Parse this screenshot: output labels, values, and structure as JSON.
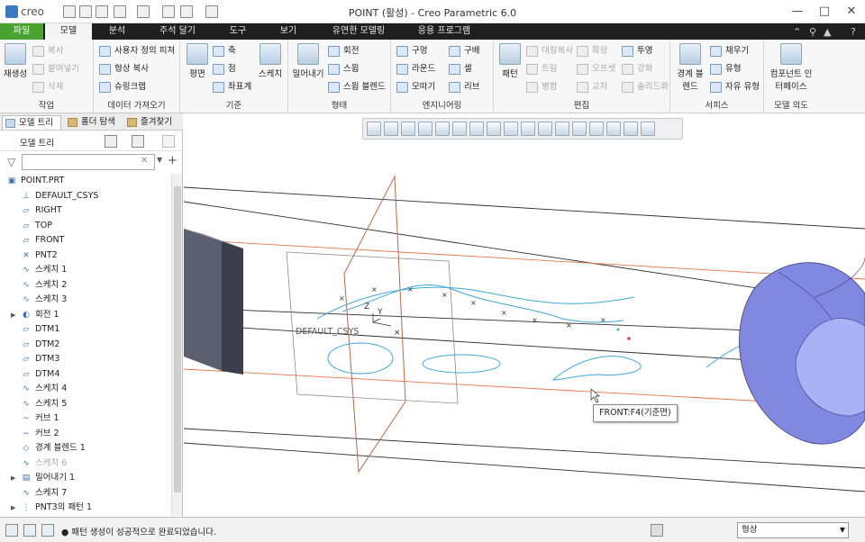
{
  "window": {
    "logo_text": "creo",
    "title": "POINT (활성) - Creo Parametric 6.0",
    "minimize": "—",
    "maximize": "□",
    "close": "✕"
  },
  "tabs": [
    "파일",
    "모델",
    "분석",
    "주석 달기",
    "도구",
    "보기",
    "유연한 모델링",
    "응용 프로그램"
  ],
  "ribbon": {
    "groups": {
      "operations": "작업",
      "get_data": "데이터 가져오기",
      "datum": "기준",
      "shapes": "형태",
      "engineering": "엔지니어링",
      "editing": "편집",
      "surfaces": "서피스",
      "model_intent": "모델 의도"
    },
    "buttons": {
      "regenerate": "재생성",
      "copy": "복사",
      "paste": "붙여넣기",
      "delete": "삭제",
      "udf": "사용자 정의 피쳐",
      "copy_geom": "형상 복사",
      "shrinkwrap": "슈링크랩",
      "plane": "평면",
      "axis": "축",
      "point": "점",
      "csys": "좌표계",
      "sketch": "스케치",
      "extrude": "밀어내기",
      "revolve": "회전",
      "sweep": "스윕",
      "swept_blend": "스윕 블렌드",
      "hole": "구멍",
      "round": "라운드",
      "chamfer": "모따기",
      "draft": "구배",
      "shell": "셸",
      "rib": "리브",
      "pattern": "패턴",
      "mirror": "대칭복사",
      "trim": "트림",
      "merge": "병합",
      "extend": "확장",
      "offset": "오프셋",
      "intersect": "교차",
      "project": "투영",
      "thicken": "강화",
      "solidify": "솔리드화",
      "boundary_blend": "경계 블렌드",
      "fill": "채우기",
      "style": "유형",
      "freestyle": "자유 유형",
      "component_interface": "컴포넌트 인터페이스"
    }
  },
  "left_panel": {
    "tabs": [
      "모델 트리",
      "폴더 탐색",
      "즐겨찾기"
    ],
    "tree_title": "모델 트리",
    "filter_placeholder": "",
    "items": [
      {
        "label": "POINT.PRT",
        "icon": "part-icon",
        "indent": 0,
        "expand": false,
        "dim": false
      },
      {
        "label": "DEFAULT_CSYS",
        "icon": "csys-icon",
        "indent": 1,
        "expand": false,
        "dim": false
      },
      {
        "label": "RIGHT",
        "icon": "datum-plane-icon",
        "indent": 1,
        "expand": false,
        "dim": false
      },
      {
        "label": "TOP",
        "icon": "datum-plane-icon",
        "indent": 1,
        "expand": false,
        "dim": false
      },
      {
        "label": "FRONT",
        "icon": "datum-plane-icon",
        "indent": 1,
        "expand": false,
        "dim": false
      },
      {
        "label": "PNT2",
        "icon": "datum-point-icon",
        "indent": 1,
        "expand": false,
        "dim": false
      },
      {
        "label": "스케치 1",
        "icon": "sketch-icon",
        "indent": 1,
        "expand": false,
        "dim": false
      },
      {
        "label": "스케치 2",
        "icon": "sketch-icon",
        "indent": 1,
        "expand": false,
        "dim": false
      },
      {
        "label": "스케치 3",
        "icon": "sketch-icon",
        "indent": 1,
        "expand": false,
        "dim": false
      },
      {
        "label": "회전 1",
        "icon": "revolve-icon",
        "indent": 1,
        "expand": true,
        "dim": false
      },
      {
        "label": "DTM1",
        "icon": "datum-plane-icon",
        "indent": 1,
        "expand": false,
        "dim": false
      },
      {
        "label": "DTM2",
        "icon": "datum-plane-icon",
        "indent": 1,
        "expand": false,
        "dim": false
      },
      {
        "label": "DTM3",
        "icon": "datum-plane-icon",
        "indent": 1,
        "expand": false,
        "dim": false
      },
      {
        "label": "DTM4",
        "icon": "datum-plane-icon",
        "indent": 1,
        "expand": false,
        "dim": false
      },
      {
        "label": "스케치 4",
        "icon": "sketch-icon",
        "indent": 1,
        "expand": false,
        "dim": false
      },
      {
        "label": "스케치 5",
        "icon": "sketch-icon",
        "indent": 1,
        "expand": false,
        "dim": false
      },
      {
        "label": "커브 1",
        "icon": "curve-icon",
        "indent": 1,
        "expand": false,
        "dim": false
      },
      {
        "label": "커브 2",
        "icon": "curve-icon",
        "indent": 1,
        "expand": false,
        "dim": false
      },
      {
        "label": "경계 블렌드 1",
        "icon": "boundary-blend-icon",
        "indent": 1,
        "expand": false,
        "dim": false
      },
      {
        "label": "스케치 6",
        "icon": "sketch-icon",
        "indent": 1,
        "expand": false,
        "dim": true
      },
      {
        "label": "밀어내기 1",
        "icon": "extrude-icon",
        "indent": 1,
        "expand": true,
        "dim": false
      },
      {
        "label": "스케치 7",
        "icon": "sketch-icon",
        "indent": 1,
        "expand": false,
        "dim": false
      },
      {
        "label": "PNT3의 패턴 1",
        "icon": "pattern-icon",
        "indent": 1,
        "expand": true,
        "dim": false
      }
    ]
  },
  "viewport": {
    "csys_label": "DEFAULT_CSYS",
    "axis_z": "Z",
    "axis_y": "Y",
    "tooltip": "FRONT:F4(기준면)"
  },
  "status": {
    "message": "● 패턴 생성이 성공적으로 완료되었습니다.",
    "filter_value": "형상"
  }
}
